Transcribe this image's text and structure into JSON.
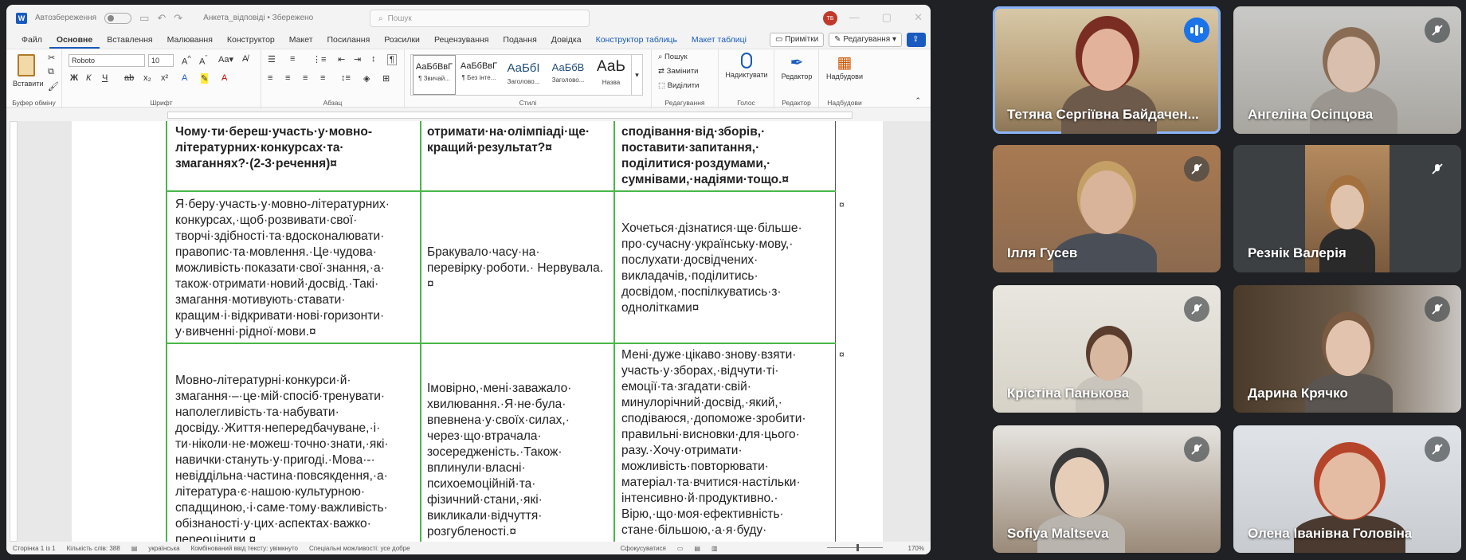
{
  "word": {
    "autosave_label": "Автозбереження",
    "doc_title": "Анкета_відповіді • Збережено",
    "search_placeholder": "Пошук",
    "user_initials": "ТБ",
    "menu_tabs": [
      "Файл",
      "Основне",
      "Вставлення",
      "Малювання",
      "Конструктор",
      "Макет",
      "Посилання",
      "Розсилки",
      "Рецензування",
      "Подання",
      "Довідка",
      "Конструктор таблиць",
      "Макет таблиці"
    ],
    "comments_btn": "Примітки",
    "editing_btn": "Редагування",
    "ribbon": {
      "paste": "Вставити",
      "clipboard_label": "Буфер обміну",
      "font_name": "Roboto",
      "font_size": "10",
      "font_label": "Шрифт",
      "paragraph_label": "Абзац",
      "styles_label": "Стилі",
      "styles": [
        {
          "sample": "АаБбВвГ",
          "name": "¶ Звичай..."
        },
        {
          "sample": "АаБбВвГ",
          "name": "¶ Без інте..."
        },
        {
          "sample": "АаБбІ",
          "name": "Заголово..."
        },
        {
          "sample": "АаБбВ",
          "name": "Заголово..."
        },
        {
          "sample": "АаЬ",
          "name": "Назва"
        }
      ],
      "find": "Пошук",
      "replace": "Замінити",
      "select": "Виділити",
      "editing_label": "Редагування",
      "dictate": "Надиктувати",
      "voice_label": "Голос",
      "editor": "Редактор",
      "editor_label": "Редактор",
      "addins": "Надбудови",
      "addins_label": "Надбудови"
    },
    "table": {
      "header": [
        "Чому·ти·береш·участь·у·мовно-літературних·конкурсах·та· змаганнях?·(2-3·речення)¤",
        "отримати·на·олімпіаді·ще· кращий·результат?¤",
        "сподівання·від·зборів,· поставити·запитання,· поділитися·роздумами,· сумнівами,·надіями·тощо.¤"
      ],
      "row1": [
        "Я·беру·участь·у·мовно-літературних· конкурсах,·щоб·розвивати·свої· творчі·здібності·та·вдосконалювати· правопис·та·мовлення.·Це·чудова· можливість·показати·свої·знання,·а· також·отримати·новий·досвід.·Такі· змагання·мотивують·ставати· кращим·і·відкривати·нові·горизонти· у·вивченні·рідної·мови.¤",
        "Бракувало·часу·на· перевірку·роботи.· Нервувала.¤",
        "Хочеться·дізнатися·ще·більше· про·сучасну·українську·мову,· послухати·досвідчених· викладачів,·поділитись· досвідом,·поспілкуватись·з· однолітками¤"
      ],
      "row2": [
        "Мовно-літературні·конкурси·й· змагання·–·це·мій·спосіб·тренувати· наполегливість·та·набувати· досвіду.·Життя·непередбачуване,·і· ти·ніколи·не·можеш·точно·знати,·які· навички·стануть·у·пригоді.·Мова·-· невіддільна·частина·повсякдення,·а· література·є·нашою·культурною· спадщиною,·і·саме·тому·важливість· обізнаності·у·цих·аспектах·важко· переоцінити.¤",
        "Імовірно,·мені·заважало· хвилювання.·Я·не·була· впевнена·у·своїх·силах,· через·що·втрачала· зосередженість.·Також· вплинули·власні· психоемоційній·та· фізичний·стани,·які· викликали·відчуття· розгубленості.¤",
        "Мені·дуже·цікаво·знову·взяти· участь·у·зборах,·відчути·ті· емоції·та·згадати·свій· минулорічний·досвід,·який,· сподіваюся,·допоможе·зробити· правильні·висновки·для·цього· разу.·Хочу·отримати· можливість·повторювати· матеріал·та·вчитися·настільки· інтенсивно·й·продуктивно.· Вірю,·що·моя·ефективність· стане·більшою,·а·я·буду·"
      ],
      "row_marks": [
        "¤",
        "¤"
      ]
    },
    "status": {
      "page": "Сторінка 1 із 1",
      "words": "Кількість слів: 388",
      "language": "українська",
      "predictive": "Комбінований ввід тексту: увімкнуто",
      "accessibility": "Спеціальні можливості: усе добре",
      "focus": "Сфокусуватися",
      "zoom": "170%"
    }
  },
  "participants": [
    {
      "name": "Тетяна Сергіївна Байдачен...",
      "state": "speaking"
    },
    {
      "name": "Ангеліна Осіпцова",
      "state": "muted"
    },
    {
      "name": "Ілля Гусев",
      "state": "muted"
    },
    {
      "name": "Резнік Валерія",
      "state": "muted"
    },
    {
      "name": "Крістіна Панькова",
      "state": "muted"
    },
    {
      "name": "Дарина Крячко",
      "state": "muted"
    },
    {
      "name": "Sofiya Maltseva",
      "state": "muted"
    },
    {
      "name": "Олена Іванівна Головіна",
      "state": "muted"
    }
  ],
  "colors": {
    "accent": "#185abd",
    "table_border": "#48b748",
    "speaking": "#1a73e8",
    "active_outline": "#8ab4f8"
  }
}
